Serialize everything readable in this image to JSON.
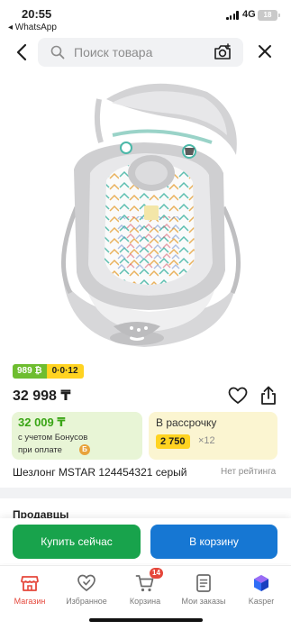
{
  "status_bar": {
    "time": "20:55",
    "back_app": "◂ WhatsApp",
    "network": "4G",
    "battery": "18"
  },
  "header": {
    "search_placeholder": "Поиск товара"
  },
  "product": {
    "badge_price": "989 ₿",
    "badge_installment": "0·0·12",
    "price": "32 998 ₸",
    "bonus_price": "32 009 ₸",
    "bonus_line1": "с учетом Бонусов",
    "bonus_line2": "при оплате",
    "bonus_coin": "Б",
    "installment_title": "В рассрочку",
    "installment_amount": "2 750",
    "installment_multiplier": "×12",
    "title": "Шезлонг MSTAR 124454321 серый",
    "rating": "Нет рейтинга"
  },
  "sections": {
    "sellers": "Продавцы"
  },
  "actions": {
    "buy_now": "Купить сейчас",
    "add_to_cart": "В корзину"
  },
  "nav": {
    "items": [
      {
        "label": "Магазин"
      },
      {
        "label": "Избранное"
      },
      {
        "label": "Корзина",
        "badge": "14"
      },
      {
        "label": "Мои заказы"
      },
      {
        "label": "Kasper"
      }
    ]
  },
  "colors": {
    "accent_red": "#e5473b",
    "buy_green": "#18a34c",
    "cart_blue": "#1677d3",
    "bonus_green": "#3aa516",
    "highlight_yellow": "#ffd321"
  }
}
